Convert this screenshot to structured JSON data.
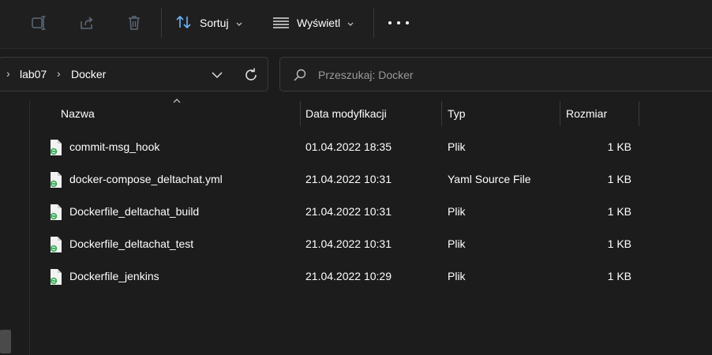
{
  "toolbar": {
    "icons": [
      "rename-icon",
      "share-icon",
      "delete-icon"
    ],
    "sort_label": "Sortuj",
    "view_label": "Wyświetl",
    "more_icon": "more-options-icon"
  },
  "address": {
    "breadcrumb": [
      "lab07",
      "Docker"
    ]
  },
  "search": {
    "placeholder": "Przeszukaj: Docker"
  },
  "columns": {
    "name": "Nazwa",
    "date": "Data modyfikacji",
    "type": "Typ",
    "size": "Rozmiar"
  },
  "files": [
    {
      "name": "commit-msg_hook",
      "date": "01.04.2022 18:35",
      "type": "Plik",
      "size": "1 KB"
    },
    {
      "name": "docker-compose_deltachat.yml",
      "date": "21.04.2022 10:31",
      "type": "Yaml Source File",
      "size": "1 KB"
    },
    {
      "name": "Dockerfile_deltachat_build",
      "date": "21.04.2022 10:31",
      "type": "Plik",
      "size": "1 KB"
    },
    {
      "name": "Dockerfile_deltachat_test",
      "date": "21.04.2022 10:31",
      "type": "Plik",
      "size": "1 KB"
    },
    {
      "name": "Dockerfile_jenkins",
      "date": "21.04.2022 10:29",
      "type": "Plik",
      "size": "1 KB"
    }
  ],
  "colors": {
    "background": "#1c1c1c",
    "accent_icon": "#6cb6ff",
    "file_badge": "#3fae5a"
  }
}
